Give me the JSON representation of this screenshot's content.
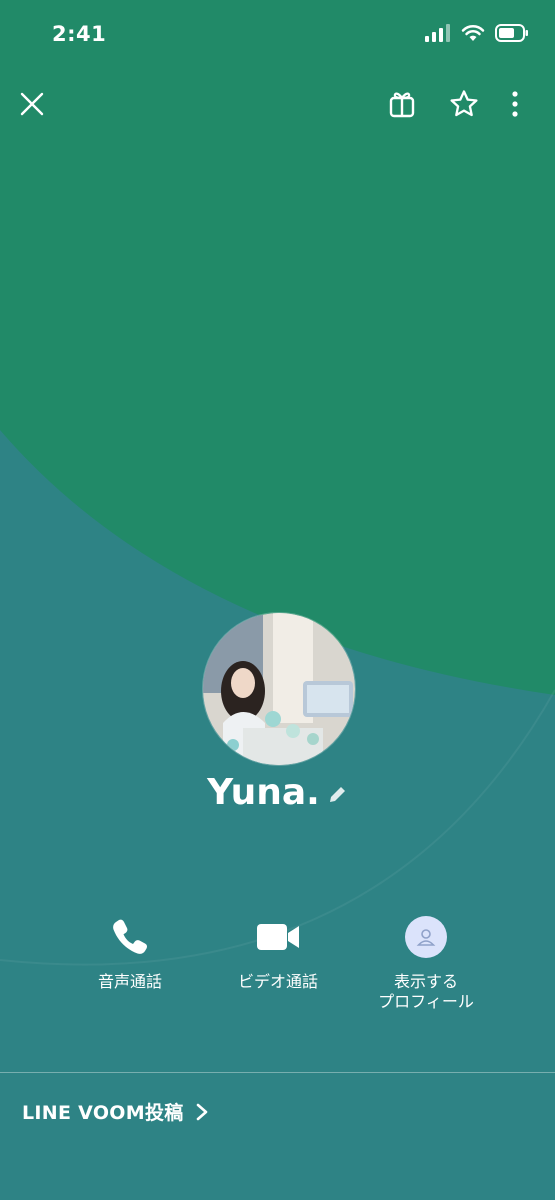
{
  "status_bar": {
    "time": "2:41"
  },
  "profile": {
    "name": "Yuna."
  },
  "actions": [
    {
      "label": "音声通話",
      "icon": "phone-icon"
    },
    {
      "label": "ビデオ通話",
      "icon": "video-camera-icon"
    },
    {
      "label": "表示する\nプロフィール",
      "icon": "profile-icon"
    }
  ],
  "voom": {
    "label": "LINE VOOM投稿"
  },
  "colors": {
    "cover_green": "#218a68",
    "background_teal": "#2e8385",
    "profile_circle": "#dbe3fb"
  }
}
